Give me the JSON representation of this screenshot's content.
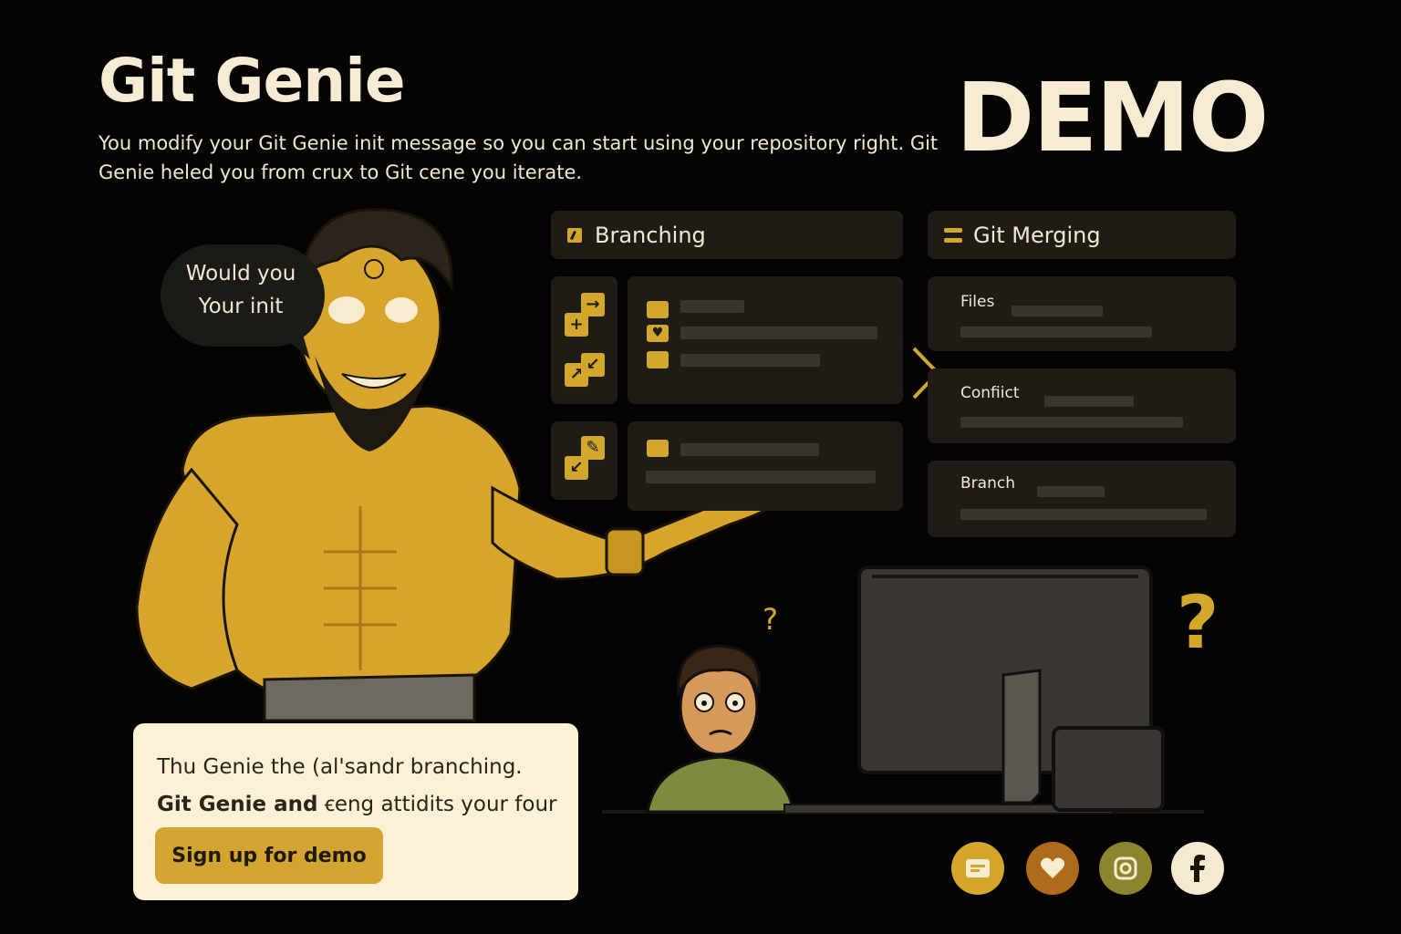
{
  "header": {
    "title": "Git Genie",
    "subtitle": "You modify your Git Genie init message so you can start using your repository right. Git Genie heled you from crux to Git cene you iterate.",
    "badge": "DEMO"
  },
  "speech_bubble": {
    "line1": "Would you",
    "line2": "Your init"
  },
  "branching_panel": {
    "title": "Branching",
    "icon": "pencil-square-icon"
  },
  "merging_panel": {
    "title": "Git Merging",
    "icon": "merge-bars-icon",
    "items": [
      {
        "label": "Files"
      },
      {
        "label": "Confiict"
      },
      {
        "label": "Branch"
      }
    ]
  },
  "card": {
    "line1": "Thu Genie the (al'sandr  branching.",
    "line2_bold": "Git Genie and",
    "line2_rest": " ꞓeng attidits your four",
    "cta_label": "Sign up for demo"
  },
  "social": [
    {
      "name": "chat-icon",
      "color": "#d4a52a"
    },
    {
      "name": "heart-icon",
      "color": "#b06a1c"
    },
    {
      "name": "instagram-icon",
      "color": "#8c842f"
    },
    {
      "name": "facebook-icon",
      "color": "#f4ead2"
    }
  ],
  "colors": {
    "background": "#050402",
    "accent": "#d3a72c",
    "panel": "#1f1c16",
    "card": "#fbf1d4",
    "text_light": "#f4ead2"
  }
}
